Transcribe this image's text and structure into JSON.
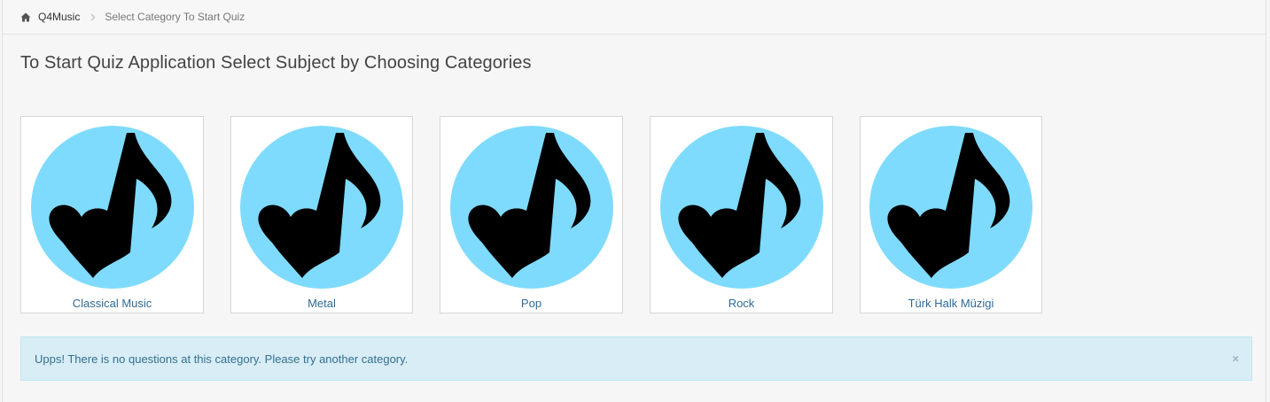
{
  "breadcrumb": {
    "home_icon": "home-icon",
    "home_label": "Q4Music",
    "separator_icon": "chevron-right-icon",
    "current_label": "Select Category To Start Quiz"
  },
  "page": {
    "title": "To Start Quiz Application Select Subject by Choosing Categories"
  },
  "categories": [
    {
      "label": "Classical Music",
      "icon": "music-note-heart-icon"
    },
    {
      "label": "Metal",
      "icon": "music-note-heart-icon"
    },
    {
      "label": "Pop",
      "icon": "music-note-heart-icon"
    },
    {
      "label": "Rock",
      "icon": "music-note-heart-icon"
    },
    {
      "label": "Türk Halk Müzigi",
      "icon": "music-note-heart-icon"
    }
  ],
  "alert": {
    "message": "Upps! There is no questions at this category. Please try another category.",
    "close_label": "×"
  },
  "colors": {
    "link": "#2f6a96",
    "icon_circle": "#7fdbfd",
    "alert_bg": "#d9edf7",
    "alert_text": "#31708f"
  }
}
